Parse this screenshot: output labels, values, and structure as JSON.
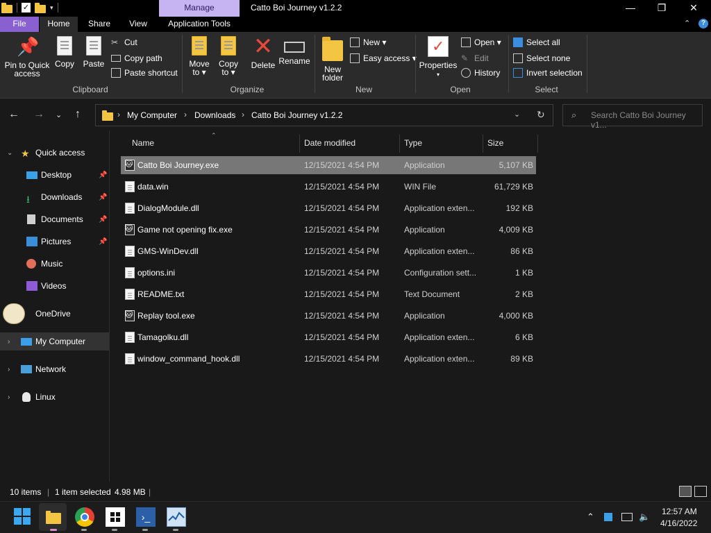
{
  "window": {
    "title": "Catto Boi Journey v1.2.2",
    "context_tab": "Manage",
    "minimize": "—",
    "maximize": "❐",
    "close": "✕"
  },
  "tabs": {
    "file": "File",
    "home": "Home",
    "share": "Share",
    "view": "View",
    "app_tools": "Application Tools"
  },
  "ribbon": {
    "clipboard": {
      "label": "Clipboard",
      "pin": "Pin to Quick\naccess",
      "copy": "Copy",
      "paste": "Paste",
      "cut": "Cut",
      "copy_path": "Copy path",
      "paste_shortcut": "Paste shortcut"
    },
    "organize": {
      "label": "Organize",
      "move_to": "Move\nto ▾",
      "copy_to": "Copy\nto ▾",
      "delete": "Delete",
      "rename": "Rename"
    },
    "new": {
      "label": "New",
      "new_folder": "New\nfolder",
      "new_item": "New ▾",
      "easy_access": "Easy access ▾"
    },
    "open": {
      "label": "Open",
      "properties": "Properties",
      "open": "Open ▾",
      "edit": "Edit",
      "history": "History"
    },
    "select": {
      "label": "Select",
      "select_all": "Select all",
      "select_none": "Select none",
      "invert": "Invert selection"
    }
  },
  "address": {
    "crumbs": [
      "My Computer",
      "Downloads",
      "Catto Boi Journey v1.2.2"
    ],
    "search_placeholder": "Search Catto Boi Journey v1..."
  },
  "sidebar": {
    "quick_access": "Quick access",
    "items": [
      "Desktop",
      "Downloads",
      "Documents",
      "Pictures",
      "Music",
      "Videos"
    ],
    "onedrive": "OneDrive",
    "my_computer": "My Computer",
    "network": "Network",
    "linux": "Linux"
  },
  "columns": {
    "name": "Name",
    "date": "Date modified",
    "type": "Type",
    "size": "Size"
  },
  "files": [
    {
      "name": "Catto Boi Journey.exe",
      "date": "12/15/2021 4:54 PM",
      "type": "Application",
      "size": "5,107 KB",
      "kind": "app"
    },
    {
      "name": "data.win",
      "date": "12/15/2021 4:54 PM",
      "type": "WIN File",
      "size": "61,729 KB",
      "kind": "file"
    },
    {
      "name": "DialogModule.dll",
      "date": "12/15/2021 4:54 PM",
      "type": "Application exten...",
      "size": "192 KB",
      "kind": "file"
    },
    {
      "name": "Game not opening fix.exe",
      "date": "12/15/2021 4:54 PM",
      "type": "Application",
      "size": "4,009 KB",
      "kind": "app"
    },
    {
      "name": "GMS-WinDev.dll",
      "date": "12/15/2021 4:54 PM",
      "type": "Application exten...",
      "size": "86 KB",
      "kind": "file"
    },
    {
      "name": "options.ini",
      "date": "12/15/2021 4:54 PM",
      "type": "Configuration sett...",
      "size": "1 KB",
      "kind": "file"
    },
    {
      "name": "README.txt",
      "date": "12/15/2021 4:54 PM",
      "type": "Text Document",
      "size": "2 KB",
      "kind": "file"
    },
    {
      "name": "Replay tool.exe",
      "date": "12/15/2021 4:54 PM",
      "type": "Application",
      "size": "4,000 KB",
      "kind": "app"
    },
    {
      "name": "Tamagolku.dll",
      "date": "12/15/2021 4:54 PM",
      "type": "Application exten...",
      "size": "6 KB",
      "kind": "file"
    },
    {
      "name": "window_command_hook.dll",
      "date": "12/15/2021 4:54 PM",
      "type": "Application exten...",
      "size": "89 KB",
      "kind": "file"
    }
  ],
  "status": {
    "count": "10 items",
    "selected": "1 item selected",
    "selected_size": "4.98 MB"
  },
  "taskbar": {
    "time": "12:57 AM",
    "date": "4/16/2022"
  },
  "colors": {
    "file_tab": "#8860d0",
    "manage_tab": "#c5b3f2",
    "selection": "#777777"
  }
}
